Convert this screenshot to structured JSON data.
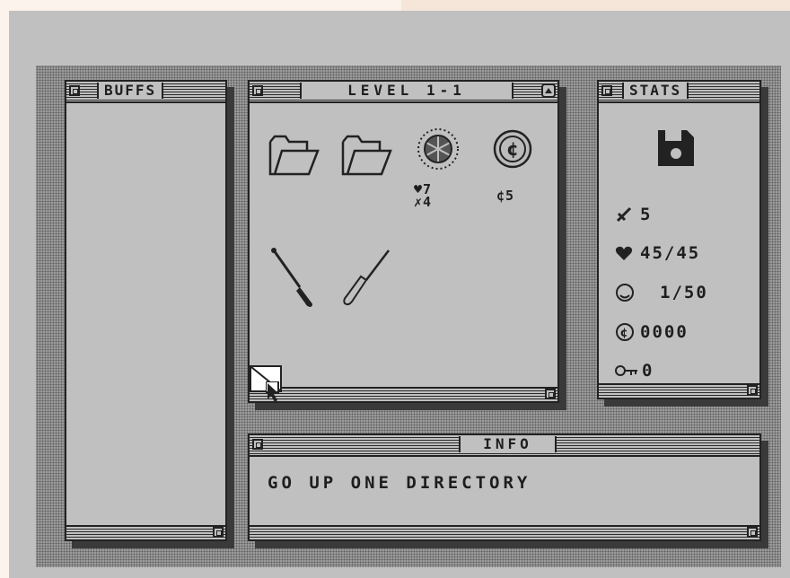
{
  "buffs": {
    "title": "BUFFS"
  },
  "level": {
    "title": "LEVEL 1-1",
    "enemy": {
      "hp": "7",
      "atk": "4"
    },
    "coin": {
      "value": "5"
    }
  },
  "stats": {
    "title": "STATS",
    "attack": "5",
    "health": "45/45",
    "xp": "1/50",
    "gold": "0000",
    "keys": "0"
  },
  "info": {
    "title": "INFO",
    "message": "GO UP ONE DIRECTORY"
  },
  "icons": [
    "folder-icon",
    "folder-icon",
    "virus-enemy-icon",
    "coin-icon",
    "screwdriver-icon",
    "screwdriver-icon",
    "floppy-disk-icon",
    "sword-icon",
    "heart-icon",
    "xp-orb-icon",
    "coin-icon",
    "key-icon",
    "cursor-icon"
  ],
  "colors": {
    "screen": "#c0c0c0",
    "ink": "#1e1e1e",
    "shadow": "#3a3a3a"
  }
}
